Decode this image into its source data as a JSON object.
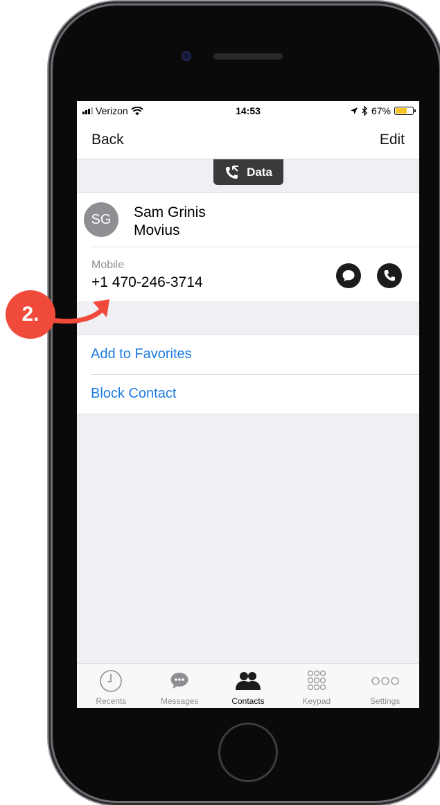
{
  "status_bar": {
    "carrier": "Verizon",
    "time": "14:53",
    "battery": "67%",
    "battery_level": 0.67
  },
  "nav": {
    "back_label": "Back",
    "edit_label": "Edit"
  },
  "badge": {
    "label": "Data"
  },
  "contact": {
    "initials": "SG",
    "name": "Sam Grinis",
    "company": "Movius",
    "phone_label": "Mobile",
    "phone_number": "+1 470-246-3714"
  },
  "actions": {
    "add_favorites": "Add to Favorites",
    "block_contact": "Block Contact"
  },
  "tabs": [
    {
      "label": "Recents",
      "icon": "clock-icon"
    },
    {
      "label": "Messages",
      "icon": "chat-bubble-icon"
    },
    {
      "label": "Contacts",
      "icon": "people-icon"
    },
    {
      "label": "Keypad",
      "icon": "keypad-icon"
    },
    {
      "label": "Settings",
      "icon": "more-icon"
    }
  ],
  "annotation": {
    "step": "2."
  },
  "colors": {
    "link": "#1e7be0",
    "annotation": "#f04a3a",
    "battery": "#f7c525"
  }
}
